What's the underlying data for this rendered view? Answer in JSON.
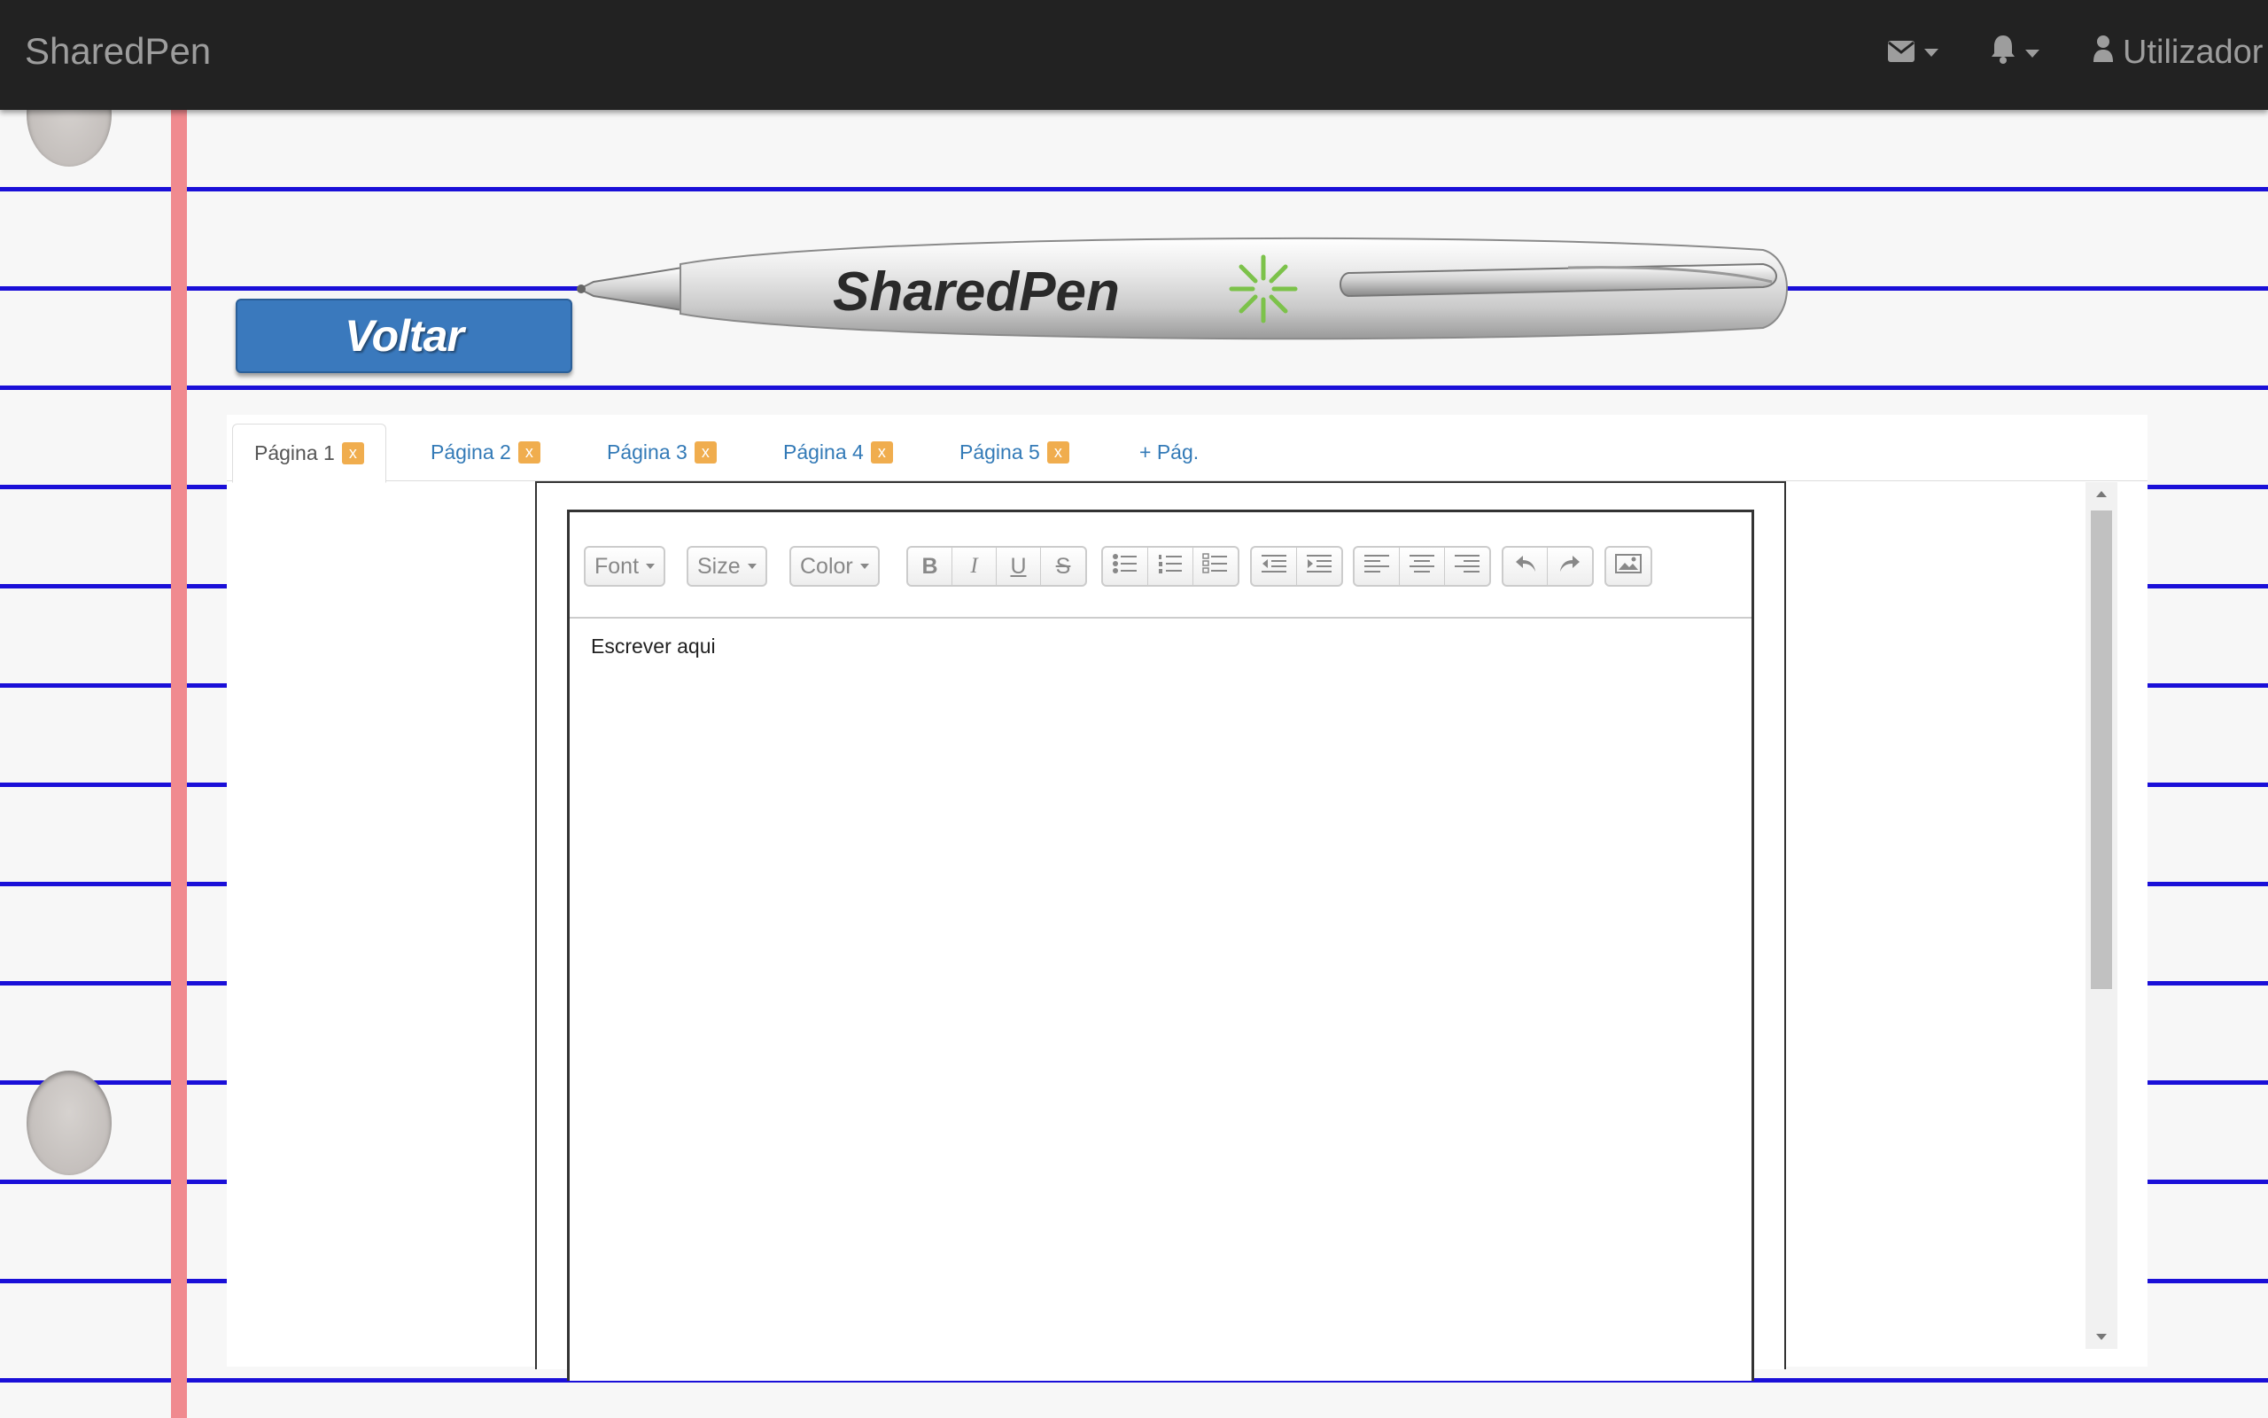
{
  "navbar": {
    "brand": "SharedPen",
    "user_label": "Utilizador",
    "icons": [
      "envelope-icon",
      "bell-icon",
      "user-icon"
    ]
  },
  "voltar_label": "Voltar",
  "logo": {
    "text": "SharedPen"
  },
  "tabs": [
    {
      "label": "Página 1",
      "close": "x",
      "active": true
    },
    {
      "label": "Página 2",
      "close": "x"
    },
    {
      "label": "Página 3",
      "close": "x"
    },
    {
      "label": "Página 4",
      "close": "x"
    },
    {
      "label": "Página 5",
      "close": "x"
    }
  ],
  "add_page_label": "+ Pág.",
  "toolbar": {
    "font": "Font",
    "size": "Size",
    "color": "Color",
    "bold": "B",
    "italic": "I",
    "underline": "U",
    "strike": "S"
  },
  "editor": {
    "content": "Escrever aqui"
  },
  "colors": {
    "navbar": "#222222",
    "button": "#3a79bd",
    "ruling": "#1a0fd8",
    "margin": "#f08a8f",
    "badge": "#f0ad4e"
  }
}
